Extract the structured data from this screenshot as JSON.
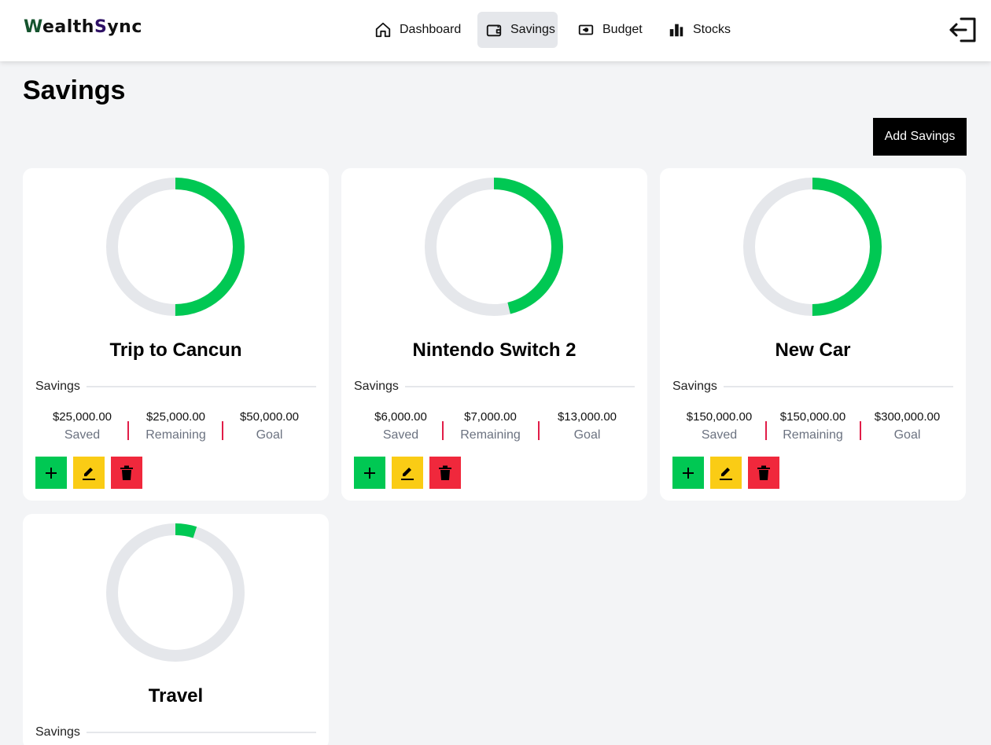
{
  "brand": {
    "w": "W",
    "part1": "ealth",
    "s": "S",
    "part2": "ync"
  },
  "nav": [
    {
      "label": "Dashboard",
      "icon": "home-icon"
    },
    {
      "label": "Savings",
      "icon": "wallet-icon",
      "active": true
    },
    {
      "label": "Budget",
      "icon": "cash-icon"
    },
    {
      "label": "Stocks",
      "icon": "bar-chart-icon"
    }
  ],
  "page": {
    "title": "Savings",
    "add_button": "Add Savings"
  },
  "colors": {
    "progress": "#00c853",
    "track": "#e5e7eb",
    "divider": "#e11d48",
    "add": "#00c853",
    "edit": "#facc15",
    "delete": "#f0283c"
  },
  "cards": [
    {
      "title": "Trip to Cancun",
      "section": "Savings",
      "saved": "$25,000.00",
      "saved_label": "Saved",
      "remaining": "$25,000.00",
      "remaining_label": "Remaining",
      "goal": "$50,000.00",
      "goal_label": "Goal",
      "progress": 0.5
    },
    {
      "title": "Nintendo Switch 2",
      "section": "Savings",
      "saved": "$6,000.00",
      "saved_label": "Saved",
      "remaining": "$7,000.00",
      "remaining_label": "Remaining",
      "goal": "$13,000.00",
      "goal_label": "Goal",
      "progress": 0.4615
    },
    {
      "title": "New Car",
      "section": "Savings",
      "saved": "$150,000.00",
      "saved_label": "Saved",
      "remaining": "$150,000.00",
      "remaining_label": "Remaining",
      "goal": "$300,000.00",
      "goal_label": "Goal",
      "progress": 0.5
    },
    {
      "title": "Travel",
      "section": "Savings",
      "progress": 0.05
    }
  ]
}
